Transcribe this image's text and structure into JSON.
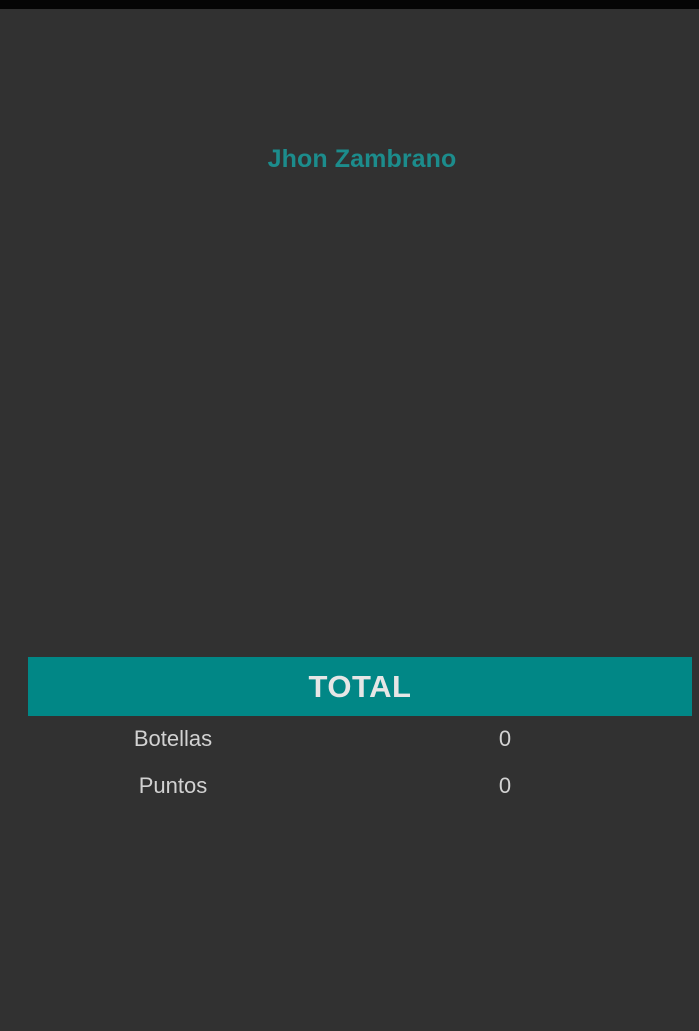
{
  "profile": {
    "user_name": "Jhon Zambrano"
  },
  "totals": {
    "title": "TOTAL",
    "rows": [
      {
        "label": "Botellas",
        "value": "0"
      },
      {
        "label": "Puntos",
        "value": "0"
      }
    ]
  },
  "colors": {
    "background": "#313131",
    "accent": "#018786",
    "name_text": "#1c8c8c",
    "body_text": "#d2d2d2"
  }
}
